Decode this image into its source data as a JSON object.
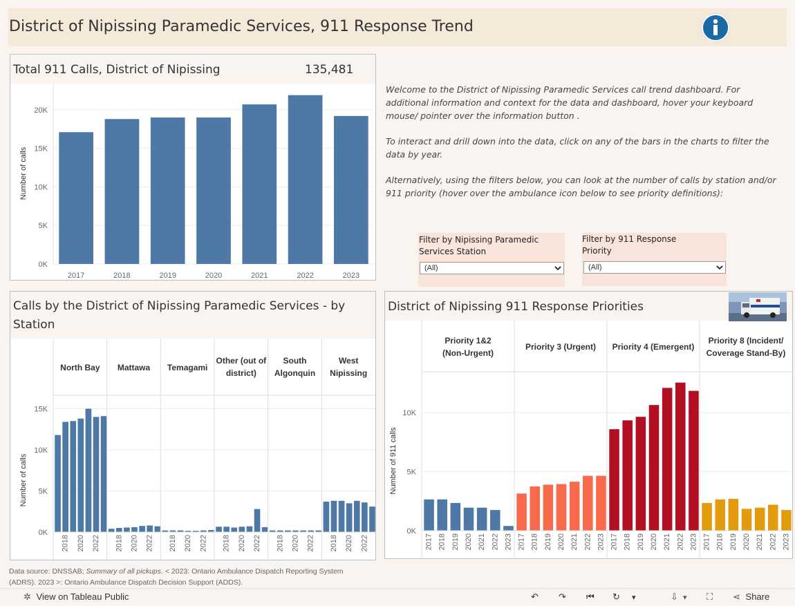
{
  "header": {
    "title": "District of Nipissing Paramedic Services, 911 Response Trend",
    "info_icon": "info-icon"
  },
  "total_panel": {
    "title": "Total 911 Calls, District of Nipissing",
    "total": "135,481"
  },
  "welcome": {
    "p1": "Welcome to the District of Nipissing Paramedic Services  call trend dashboard. For additional information and context for the data and dashboard, hover your keyboard mouse/ pointer over the information button .",
    "p2": "To interact and drill down into the data, click on any of the bars in the charts to filter the data by year.",
    "p3": "Alternatively, using the filters below, you can look at the number of calls by station and/or 911 priority (hover over the ambulance icon below to see priority definitions):"
  },
  "filters": {
    "station": {
      "label": "Filter by Nipissing Paramedic Services Station",
      "value": "(All)"
    },
    "priority": {
      "label": "Filter by 911 Response Priority",
      "value": "(All)"
    }
  },
  "station_panel": {
    "title": "Calls by the District of Nipissing Paramedic Services - by Station"
  },
  "priority_panel": {
    "title": "District of Nipissing 911 Response Priorities",
    "image_icon": "ambulance-photo"
  },
  "footer": {
    "source_line1_a": "Data source: DNSSAB; ",
    "source_line1_b": "Summary of all pickups",
    "source_line1_c": ". < 2023: Ontario Ambulance Dispatch Reporting System",
    "source_line2": "(ADRS). 2023 >: Ontario Ambulance Dispatch Decision Support (ADDS)."
  },
  "toolbar": {
    "view_label": "View on Tableau Public",
    "share_label": "Share"
  },
  "chart_data": [
    {
      "type": "bar",
      "id": "total",
      "categories": [
        "2017",
        "2018",
        "2019",
        "2020",
        "2021",
        "2022",
        "2023"
      ],
      "values": [
        17100,
        18800,
        19000,
        19000,
        20700,
        21900,
        19200
      ],
      "ylabel": "Number of calls",
      "yticks": [
        "0K",
        "5K",
        "10K",
        "15K",
        "20K"
      ],
      "ylim": [
        0,
        22500
      ],
      "color": "#4e79a7"
    },
    {
      "type": "bar",
      "id": "station",
      "ylabel": "Number of calls",
      "yticks": [
        "0K",
        "5K",
        "10K",
        "15K"
      ],
      "ylim": [
        0,
        16300
      ],
      "color": "#4e79a7",
      "years": [
        "2017",
        "2018",
        "2019",
        "2020",
        "2021",
        "2022",
        "2023"
      ],
      "xtick_labels": [
        "2018",
        "2020",
        "2022"
      ],
      "series": [
        {
          "name": "North Bay",
          "values": [
            11800,
            13400,
            13500,
            13800,
            15000,
            14000,
            14100
          ]
        },
        {
          "name": "Mattawa",
          "values": [
            400,
            500,
            550,
            600,
            750,
            800,
            700
          ]
        },
        {
          "name": "Temagami",
          "values": [
            200,
            200,
            200,
            150,
            150,
            200,
            250
          ]
        },
        {
          "name": "Other (out of district)",
          "values": [
            650,
            650,
            550,
            650,
            700,
            2800,
            600
          ]
        },
        {
          "name": "South Algonquin",
          "values": [
            200,
            200,
            200,
            200,
            200,
            200,
            200
          ]
        },
        {
          "name": "West Nipissing",
          "values": [
            3700,
            3800,
            3800,
            3500,
            3800,
            3600,
            3100
          ]
        }
      ]
    },
    {
      "type": "bar",
      "id": "priority",
      "ylabel": "Number of 911 calls",
      "yticks": [
        "0K",
        "5K",
        "10K"
      ],
      "ylim": [
        0,
        13000
      ],
      "years": [
        "2017",
        "2018",
        "2019",
        "2020",
        "2021",
        "2022",
        "2023"
      ],
      "series": [
        {
          "name": "Priority 1&2\n(Non-Urgent)",
          "color": "#4e79a7",
          "values": [
            2650,
            2650,
            2350,
            1950,
            1950,
            1750,
            400
          ]
        },
        {
          "name": "Priority 3 (Urgent)",
          "color": "#f86a4b",
          "values": [
            3150,
            3750,
            3900,
            3950,
            4150,
            4650,
            4650
          ]
        },
        {
          "name": "Priority 4 (Emergent)",
          "color": "#b30f23",
          "values": [
            8600,
            9350,
            9650,
            10650,
            12100,
            12550,
            11850
          ]
        },
        {
          "name": "Priority 8 (Incident/\nCoverage Stand-By)",
          "color": "#e39b0e",
          "values": [
            2350,
            2650,
            2700,
            1850,
            1950,
            2200,
            1750
          ]
        }
      ]
    }
  ]
}
